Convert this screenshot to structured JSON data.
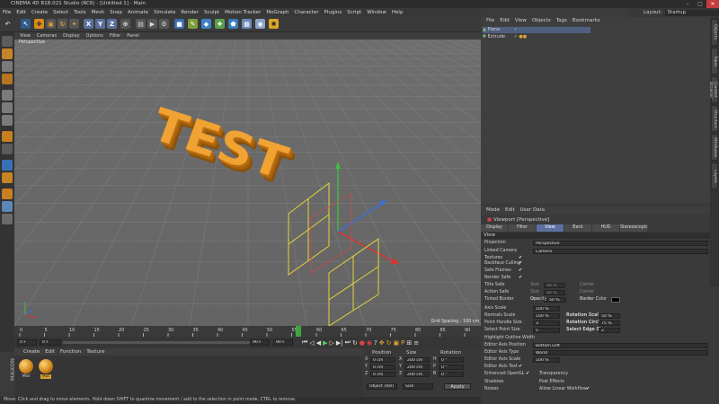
{
  "window": {
    "title": "CINEMA 4D R18.021 Studio (RC6) - [Untitled 1] - Main",
    "layout_label": "Layout:",
    "layout_value": "Startup"
  },
  "menu": [
    "File",
    "Edit",
    "Create",
    "Select",
    "Tools",
    "Mesh",
    "Snap",
    "Animate",
    "Simulate",
    "Render",
    "Sculpt",
    "Motion Tracker",
    "MoGraph",
    "Character",
    "Plugins",
    "Script",
    "Window",
    "Help"
  ],
  "viewport": {
    "menu": [
      "View",
      "Cameras",
      "Display",
      "Options",
      "Filter",
      "Panel"
    ],
    "name": "Perspective",
    "text3d": "TEST",
    "grid_spacing": "Grid Spacing : 100 cm"
  },
  "timeline": {
    "ticks": [
      "0",
      "5",
      "10",
      "15",
      "20",
      "25",
      "30",
      "35",
      "40",
      "45",
      "50",
      "55",
      "60",
      "65",
      "70",
      "75",
      "80",
      "85",
      "90"
    ],
    "current_frame": "0 F",
    "start": "0 F",
    "end": "90 F",
    "end2": "90 F",
    "max": "90 F"
  },
  "materials": {
    "menu": [
      "Create",
      "Edit",
      "Function",
      "Texture"
    ],
    "items": [
      {
        "name": "Mat"
      },
      {
        "name": "Mat"
      }
    ]
  },
  "coords": {
    "headers": [
      "Position",
      "Size",
      "Rotation"
    ],
    "rows": [
      {
        "axis": "X",
        "pos": "0 cm",
        "axis2": "X",
        "size": "200 cm",
        "axis3": "H",
        "rot": "0 °"
      },
      {
        "axis": "Y",
        "pos": "0 cm",
        "axis2": "Y",
        "size": "200 cm",
        "axis3": "P",
        "rot": "0 °"
      },
      {
        "axis": "Z",
        "pos": "0 cm",
        "axis2": "Z",
        "size": "200 cm",
        "axis3": "B",
        "rot": "0 °"
      }
    ],
    "mode": "Object (Rel)",
    "size_mode": "Size",
    "apply": "Apply"
  },
  "status": "Move: Click and drag to move elements. Hold down SHIFT to quantize movement / add to the selection in point mode, CTRL to remove.",
  "objects": {
    "menu": [
      "File",
      "Edit",
      "View",
      "Objects",
      "Tags",
      "Bookmarks"
    ],
    "items": [
      {
        "name": "Plane"
      },
      {
        "name": "Extrude"
      }
    ]
  },
  "attributes": {
    "menu": [
      "Mode",
      "Edit",
      "User Data"
    ],
    "title": "Viewport [Perspective]",
    "tabs": [
      "Display",
      "Filter",
      "View",
      "Back",
      "HUD",
      "Stereoscopic"
    ],
    "active_tab": "View",
    "section": "View",
    "rows": [
      {
        "label": "Projection",
        "value": "Perspective"
      },
      {
        "label": "Linked Camera",
        "value": "Camera"
      },
      {
        "label": "Textures",
        "value": "✔"
      },
      {
        "label": "Backface Culling",
        "value": "✔"
      },
      {
        "label": "Safe Frames",
        "value": "✔"
      },
      {
        "label": "Render Safe",
        "value": "✔"
      },
      {
        "label": "Title Safe",
        "value": ""
      },
      {
        "label": "Action Safe",
        "value": ""
      },
      {
        "label": "Tinted Border",
        "value": ""
      },
      {
        "label": "Axis Scale",
        "value": "100 %"
      },
      {
        "label": "Normals Scale",
        "value": "100 %"
      },
      {
        "label": "Point Handle Size",
        "value": "3"
      },
      {
        "label": "Select Point Size",
        "value": "5"
      },
      {
        "label": "Highlight Outline Width",
        "value": ""
      },
      {
        "label": "Editor Axis Position",
        "value": "Bottom Left"
      },
      {
        "label": "Editor Axis Type",
        "value": "World"
      },
      {
        "label": "Editor Axis Scale",
        "value": "100 %"
      },
      {
        "label": "Editor Axis Text",
        "value": "✔"
      },
      {
        "label": "Enhanced OpenGL",
        "value": "✔"
      },
      {
        "label": "Shadows",
        "value": ""
      },
      {
        "label": "Noises",
        "value": ""
      }
    ],
    "safe_sub": [
      {
        "label": "Size",
        "value": "90 %",
        "center": "Center"
      },
      {
        "label": "Size",
        "value": "80 %",
        "center": "Center"
      },
      {
        "label": "Size",
        "value": "90 %",
        "center": "Center"
      }
    ],
    "opacity_label": "Opacity",
    "opacity_value": "50 %",
    "border_color_label": "Border Color",
    "rotation_scale_label": "Rotation Scale",
    "rotation_scale_value": "50 %",
    "rotation_circle_label": "Rotation Circle",
    "rotation_circle_value": "75 %",
    "select_edge_label": "Select Edge Size",
    "select_edge_value": "2",
    "transparency_label": "Transparency",
    "post_effects_label": "Post Effects",
    "linear_workflow_label": "Allow Linear Workflow",
    "linear_workflow_value": "✔"
  },
  "side_tabs": [
    "Objects",
    "Takes",
    "Content Browser",
    "Structure",
    "Attributes",
    "Layers"
  ],
  "colors": {
    "accent": "#5b6fa0",
    "text_orange": "#e8921e",
    "grid": "#6d6d6d"
  }
}
